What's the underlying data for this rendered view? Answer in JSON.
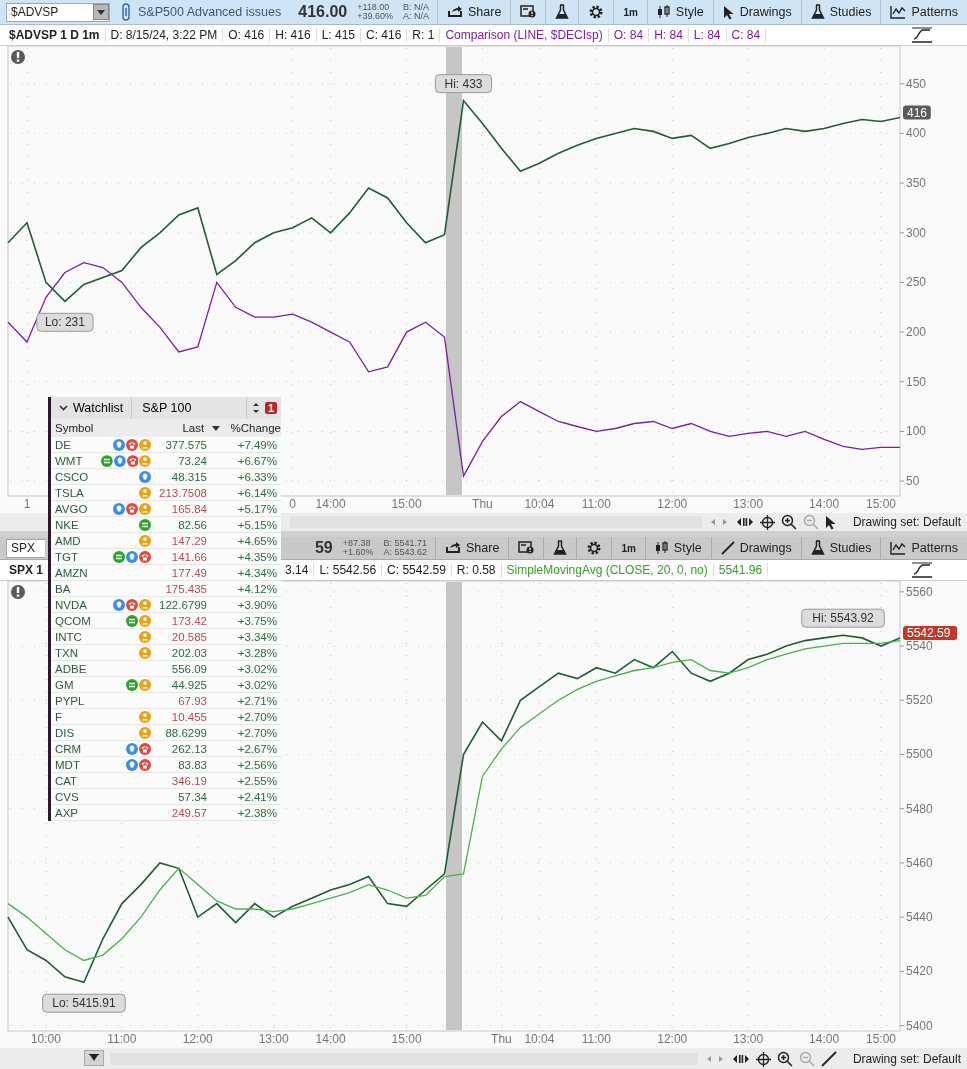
{
  "panels": [
    {
      "active": true,
      "toolbar": {
        "symbol": "$ADVSP",
        "description": "S&P500 Advanced issues",
        "price": "416.00",
        "change": "+118.00",
        "change_pct": "+39.60%",
        "bid": "B: N/A",
        "ask": "A: N/A",
        "buttons": [
          {
            "kind": "share",
            "label": "Share"
          },
          {
            "kind": "news"
          },
          {
            "kind": "flask"
          },
          {
            "kind": "gear"
          },
          {
            "kind": "interval",
            "label": "1m"
          },
          {
            "kind": "style",
            "label": "Style"
          },
          {
            "kind": "pointer",
            "label": "Drawings"
          },
          {
            "kind": "studies",
            "label": "Studies"
          },
          {
            "kind": "patterns",
            "label": "Patterns"
          }
        ]
      },
      "header": [
        {
          "kind": "title",
          "text": "$ADVSP 1 D 1m"
        },
        {
          "kind": "info",
          "text": "D: 8/15/24, 3:22 PM"
        },
        {
          "kind": "info",
          "text": "O: 416"
        },
        {
          "kind": "info",
          "text": "H: 416"
        },
        {
          "kind": "info",
          "text": "L: 415"
        },
        {
          "kind": "info",
          "text": "C: 416"
        },
        {
          "kind": "info",
          "text": "R: 1"
        },
        {
          "kind": "study",
          "text": "Comparison (LINE, $DECIsp)",
          "color": "#7b1fa2"
        },
        {
          "kind": "study",
          "text": "O: 84",
          "color": "#7b1fa2"
        },
        {
          "kind": "study",
          "text": "H: 84",
          "color": "#7b1fa2"
        },
        {
          "kind": "study",
          "text": "L: 84",
          "color": "#7b1fa2"
        },
        {
          "kind": "study",
          "text": "C: 84",
          "color": "#7b1fa2"
        }
      ],
      "chart_data": {
        "type": "line",
        "grid": true,
        "ylim": [
          35,
          488
        ],
        "yticks": [
          50,
          100,
          150,
          200,
          250,
          300,
          350,
          400,
          450
        ],
        "categories": [
          null,
          "1",
          null,
          null,
          null,
          null,
          null,
          null,
          null,
          null,
          null,
          null,
          null,
          null,
          null,
          "0",
          null,
          "14:00",
          null,
          null,
          null,
          "15:00",
          null,
          null,
          null,
          "Thu",
          null,
          null,
          "10:04",
          null,
          null,
          "11:00",
          null,
          null,
          null,
          "12:00",
          null,
          null,
          null,
          "13:00",
          null,
          null,
          null,
          "14:00",
          null,
          null,
          "15:00",
          null
        ],
        "series": [
          {
            "color": "#1f5e33",
            "values": [
              290,
              310,
              250,
              231,
              248,
              255,
              262,
              285,
              300,
              318,
              325,
              258,
              272,
              290,
              300,
              305,
              315,
              300,
              320,
              345,
              335,
              310,
              290,
              298,
              433,
              410,
              385,
              362,
              370,
              380,
              388,
              395,
              400,
              405,
              402,
              395,
              398,
              385,
              390,
              396,
              400,
              405,
              402,
              405,
              410,
              414,
              412,
              416
            ]
          },
          {
            "color": "#7b1fa2",
            "values": [
              210,
              190,
              235,
              260,
              270,
              265,
              250,
              225,
              205,
              180,
              185,
              250,
              225,
              215,
              215,
              218,
              210,
              200,
              190,
              160,
              165,
              200,
              210,
              195,
              55,
              90,
              115,
              130,
              120,
              110,
              105,
              100,
              103,
              108,
              110,
              103,
              108,
              100,
              95,
              98,
              100,
              95,
              100,
              92,
              85,
              82,
              84,
              84
            ]
          }
        ],
        "annotations": [
          {
            "text": "Hi: 433",
            "y": 433
          },
          {
            "text": "Lo: 231",
            "y": 231
          }
        ]
      },
      "last_price_label": {
        "text": "416",
        "down": false
      },
      "status": {
        "drawing_set": "Drawing set: Default",
        "kind": "pointer"
      }
    },
    {
      "active": false,
      "toolbar": {
        "symbol": "SPX",
        "price": "59",
        "change": "+87.38",
        "change_pct": "+1.60%",
        "bid": "B: 5541.71",
        "ask": "A: 5543.62",
        "buttons": [
          {
            "kind": "share",
            "label": "Share"
          },
          {
            "kind": "news"
          },
          {
            "kind": "flask"
          },
          {
            "kind": "gear"
          },
          {
            "kind": "interval",
            "label": "1m"
          },
          {
            "kind": "style",
            "label": "Style"
          },
          {
            "kind": "line",
            "label": "Drawings"
          },
          {
            "kind": "studies",
            "label": "Studies"
          },
          {
            "kind": "patterns",
            "label": "Patterns"
          }
        ]
      },
      "header": [
        {
          "kind": "title",
          "text": "SPX 1"
        },
        {
          "kind": "info",
          "text": "3.14"
        },
        {
          "kind": "info",
          "text": "L: 5542.56"
        },
        {
          "kind": "info",
          "text": "C: 5542.59"
        },
        {
          "kind": "info",
          "text": "R: 0.58"
        },
        {
          "kind": "study",
          "text": "SimpleMovingAvg (CLOSE, 20, 0, no)",
          "color": "#3c9a2c"
        },
        {
          "kind": "study",
          "text": "5541.96",
          "color": "#3c9a2c"
        }
      ],
      "chart_data": {
        "type": "line",
        "grid": true,
        "ylim": [
          5398,
          5564
        ],
        "yticks": [
          5400,
          5420,
          5440,
          5460,
          5480,
          5500,
          5520,
          5540,
          5560
        ],
        "categories": [
          null,
          null,
          "10:00",
          null,
          null,
          null,
          "11:00",
          null,
          null,
          null,
          "12:00",
          null,
          null,
          null,
          "13:00",
          null,
          null,
          "14:00",
          null,
          null,
          null,
          "15:00",
          null,
          null,
          null,
          null,
          "Thu",
          null,
          "10:04",
          null,
          null,
          "11:00",
          null,
          null,
          null,
          "12:00",
          null,
          null,
          null,
          "13:00",
          null,
          null,
          null,
          "14:00",
          null,
          null,
          "15:00",
          null
        ],
        "series": [
          {
            "color": "#1f5e33",
            "values": [
              5440,
              5428,
              5424,
              5418,
              5416,
              5432,
              5445,
              5452,
              5460,
              5458,
              5440,
              5445,
              5438,
              5445,
              5440,
              5444,
              5447,
              5450,
              5452,
              5455,
              5445,
              5444,
              5450,
              5456,
              5500,
              5512,
              5505,
              5520,
              5525,
              5530,
              5528,
              5532,
              5530,
              5535,
              5532,
              5538,
              5530,
              5527,
              5530,
              5535,
              5537,
              5540,
              5542,
              5543,
              5544,
              5543,
              5540,
              5543
            ]
          },
          {
            "color": "#4caf50",
            "values": [
              5445,
              5440,
              5434,
              5428,
              5424,
              5426,
              5432,
              5440,
              5450,
              5458,
              5452,
              5446,
              5443,
              5443,
              5442,
              5443,
              5445,
              5447,
              5449,
              5452,
              5450,
              5447,
              5448,
              5455,
              5456,
              5492,
              5502,
              5510,
              5515,
              5520,
              5524,
              5527,
              5529,
              5531,
              5532,
              5534,
              5535,
              5531,
              5530,
              5532,
              5535,
              5537,
              5539,
              5540,
              5541,
              5541,
              5541,
              5542
            ]
          }
        ],
        "annotations": [
          {
            "text": "Hi: 5543.92",
            "y": 5544
          },
          {
            "text": "Lo: 5415.91",
            "y": 5416
          }
        ]
      },
      "last_price_label": {
        "text": "5542.59",
        "down": true
      },
      "status": {
        "drawing_set": "Drawing set: Default",
        "kind": "line"
      }
    }
  ],
  "watchlist": {
    "title": "Watchlist",
    "list": "S&P 100",
    "badge": "1",
    "columns": [
      "Symbol",
      "Last",
      "%Change"
    ],
    "rows": [
      {
        "symbol": "DE",
        "icons": [
          {
            "kind": "bulb"
          },
          {
            "kind": "phone"
          },
          {
            "kind": "person"
          }
        ],
        "last": "377.575",
        "up": true,
        "change": "+7.49%"
      },
      {
        "symbol": "WMT",
        "icons": [
          {
            "kind": "stripe"
          },
          {
            "kind": "bulb"
          },
          {
            "kind": "phone"
          },
          {
            "kind": "person"
          }
        ],
        "last": "73.24",
        "up": true,
        "change": "+6.67%"
      },
      {
        "symbol": "CSCO",
        "icons": [
          {
            "kind": "bulb"
          }
        ],
        "last": "48.315",
        "up": true,
        "change": "+6.33%"
      },
      {
        "symbol": "TSLA",
        "icons": [
          {
            "kind": "person"
          }
        ],
        "last": "213.7508",
        "up": false,
        "change": "+6.14%"
      },
      {
        "symbol": "AVGO",
        "icons": [
          {
            "kind": "bulb"
          },
          {
            "kind": "phone"
          },
          {
            "kind": "person"
          }
        ],
        "last": "165.84",
        "up": false,
        "change": "+5.17%"
      },
      {
        "symbol": "NKE",
        "icons": [
          {
            "kind": "stripe"
          }
        ],
        "last": "82.56",
        "up": true,
        "change": "+5.15%"
      },
      {
        "symbol": "AMD",
        "icons": [
          {
            "kind": "person"
          }
        ],
        "last": "147.29",
        "up": false,
        "change": "+4.65%"
      },
      {
        "symbol": "TGT",
        "icons": [
          {
            "kind": "stripe"
          },
          {
            "kind": "bulb"
          },
          {
            "kind": "phone"
          }
        ],
        "last": "141.66",
        "up": false,
        "change": "+4.35%"
      },
      {
        "symbol": "AMZN",
        "last": "177.49",
        "up": false,
        "change": "+4.34%"
      },
      {
        "symbol": "BA",
        "last": "175.435",
        "up": false,
        "change": "+4.12%"
      },
      {
        "symbol": "NVDA",
        "icons": [
          {
            "kind": "bulb"
          },
          {
            "kind": "phone"
          },
          {
            "kind": "person"
          }
        ],
        "last": "122.6799",
        "up": true,
        "change": "+3.90%"
      },
      {
        "symbol": "QCOM",
        "icons": [
          {
            "kind": "stripe"
          },
          {
            "kind": "person"
          }
        ],
        "last": "173.42",
        "up": false,
        "change": "+3.75%"
      },
      {
        "symbol": "INTC",
        "icons": [
          {
            "kind": "person"
          }
        ],
        "last": "20.585",
        "up": false,
        "change": "+3.34%"
      },
      {
        "symbol": "TXN",
        "icons": [
          {
            "kind": "person"
          }
        ],
        "last": "202.03",
        "up": true,
        "change": "+3.28%"
      },
      {
        "symbol": "ADBE",
        "last": "556.09",
        "up": true,
        "change": "+3.02%"
      },
      {
        "symbol": "GM",
        "icons": [
          {
            "kind": "stripe"
          },
          {
            "kind": "person"
          }
        ],
        "last": "44.925",
        "up": true,
        "change": "+3.02%"
      },
      {
        "symbol": "PYPL",
        "last": "67.93",
        "up": false,
        "change": "+2.71%"
      },
      {
        "symbol": "F",
        "icons": [
          {
            "kind": "person"
          }
        ],
        "last": "10.455",
        "up": false,
        "change": "+2.70%"
      },
      {
        "symbol": "DIS",
        "icons": [
          {
            "kind": "person"
          }
        ],
        "last": "88.6299",
        "up": true,
        "change": "+2.70%"
      },
      {
        "symbol": "CRM",
        "icons": [
          {
            "kind": "bulb"
          },
          {
            "kind": "phone"
          }
        ],
        "last": "262.13",
        "up": true,
        "change": "+2.67%"
      },
      {
        "symbol": "MDT",
        "icons": [
          {
            "kind": "bulb"
          },
          {
            "kind": "phone"
          }
        ],
        "last": "83.83",
        "up": true,
        "change": "+2.56%"
      },
      {
        "symbol": "CAT",
        "last": "346.19",
        "up": false,
        "change": "+2.55%"
      },
      {
        "symbol": "CVS",
        "last": "57.34",
        "up": true,
        "change": "+2.41%"
      },
      {
        "symbol": "AXP",
        "last": "249.57",
        "up": false,
        "change": "+2.38%"
      }
    ]
  }
}
